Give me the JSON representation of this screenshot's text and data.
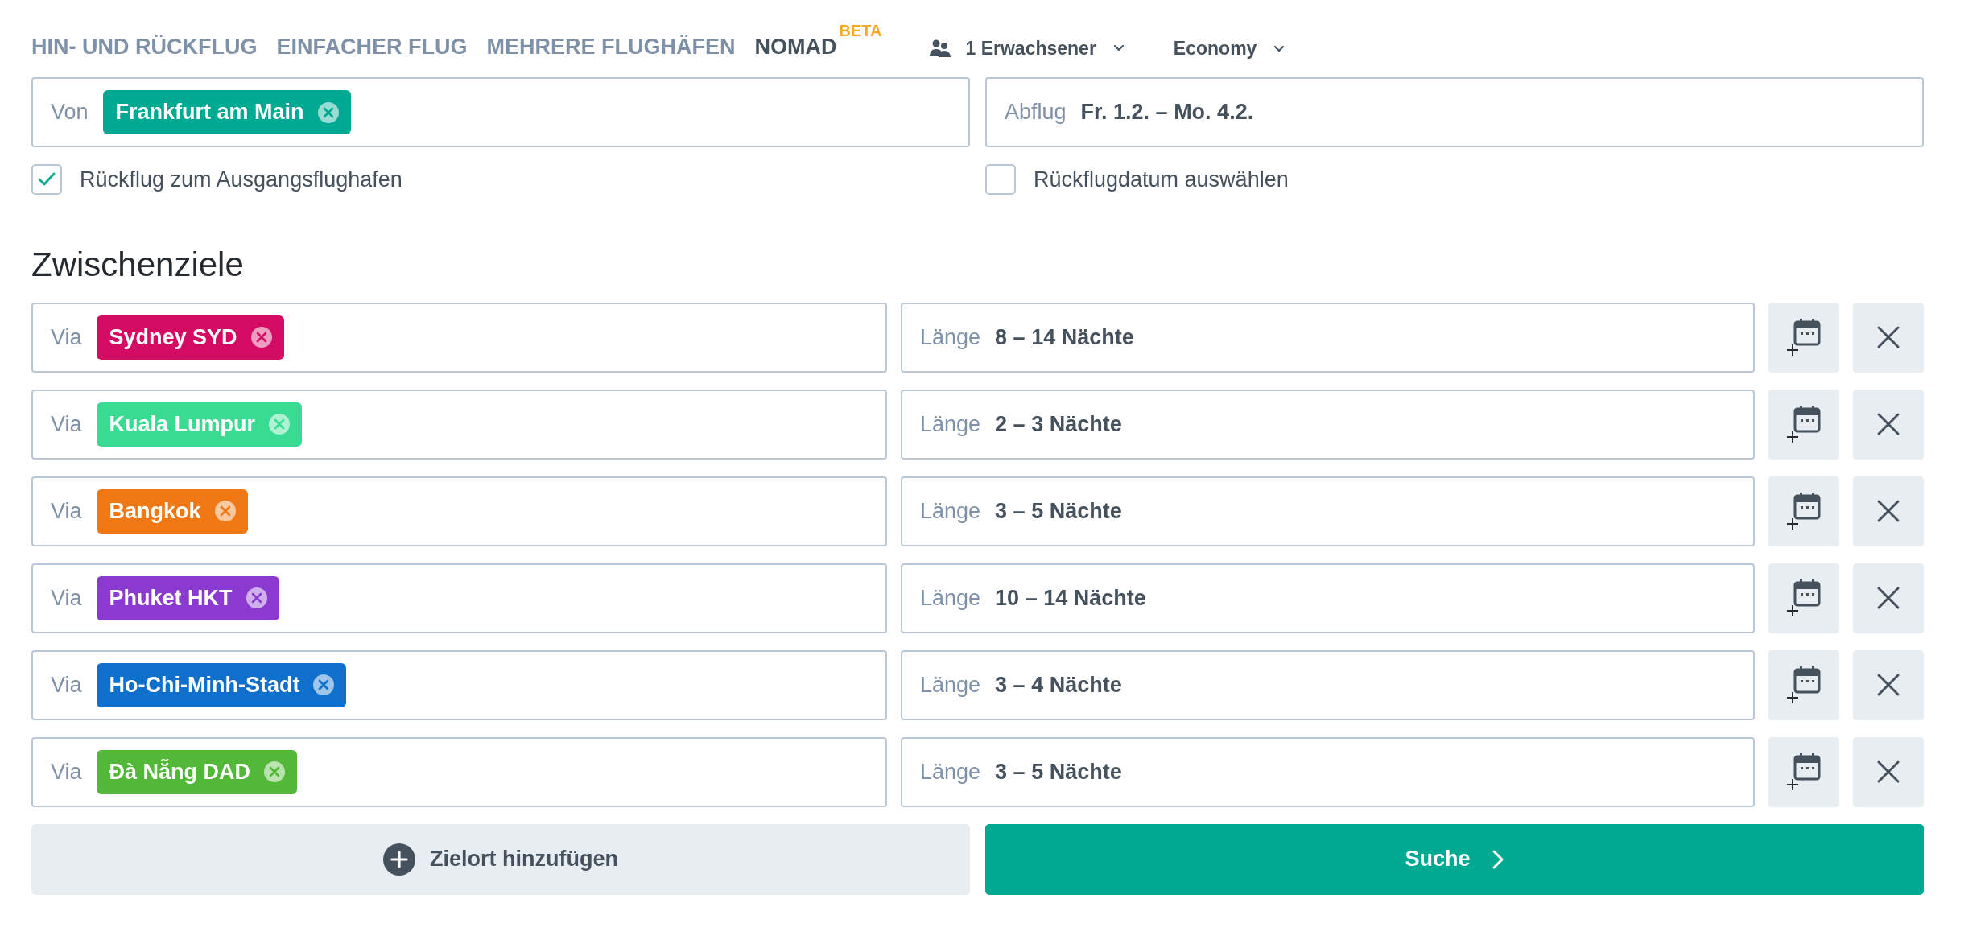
{
  "tabs": [
    {
      "label": "HIN- UND RÜCKFLUG",
      "selected": false
    },
    {
      "label": "EINFACHER FLUG",
      "selected": false
    },
    {
      "label": "MEHRERE FLUGHÄFEN",
      "selected": false
    },
    {
      "label": "NOMAD",
      "badge": "BETA",
      "selected": true
    }
  ],
  "passengers": {
    "label": "1 Erwachsener"
  },
  "cabin_class": {
    "label": "Economy"
  },
  "origin": {
    "label": "Von",
    "chip": {
      "text": "Frankfurt am Main",
      "color": "#00a991"
    }
  },
  "departure": {
    "label": "Abflug",
    "value": "Fr. 1.2. – Mo. 4.2."
  },
  "return_to_origin": {
    "label": "Rückflug zum Ausgangsflughafen",
    "checked": true
  },
  "choose_return_date": {
    "label": "Rückflugdatum auswählen",
    "checked": false
  },
  "stops_heading": "Zwischenziele",
  "stops": [
    {
      "via_label": "Via",
      "chip": {
        "text": "Sydney SYD",
        "color": "#d30b63"
      },
      "length_label": "Länge",
      "length": "8 – 14 Nächte"
    },
    {
      "via_label": "Via",
      "chip": {
        "text": "Kuala Lumpur",
        "color": "#38db91"
      },
      "length_label": "Länge",
      "length": "2 – 3 Nächte"
    },
    {
      "via_label": "Via",
      "chip": {
        "text": "Bangkok",
        "color": "#f07814"
      },
      "length_label": "Länge",
      "length": "3 – 5 Nächte"
    },
    {
      "via_label": "Via",
      "chip": {
        "text": "Phuket HKT",
        "color": "#8b3ad0"
      },
      "length_label": "Länge",
      "length": "10 – 14 Nächte"
    },
    {
      "via_label": "Via",
      "chip": {
        "text": "Ho-Chi-Minh-Stadt",
        "color": "#0f6fcc"
      },
      "length_label": "Länge",
      "length": "3 – 4 Nächte"
    },
    {
      "via_label": "Via",
      "chip": {
        "text": "Đà Nẵng DAD",
        "color": "#52b838"
      },
      "length_label": "Länge",
      "length": "3 – 5 Nächte"
    }
  ],
  "add_stop_button": "Zielort hinzufügen",
  "search_button": "Suche"
}
